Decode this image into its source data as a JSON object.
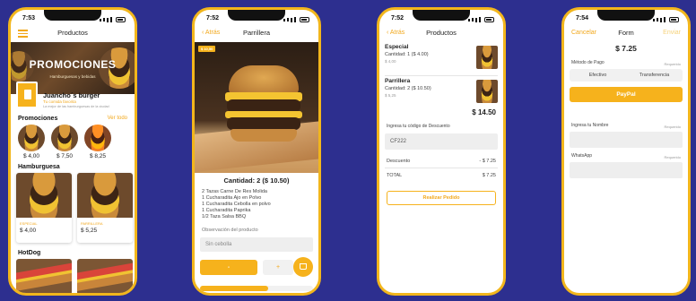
{
  "screen1": {
    "time": "7:53",
    "title": "Productos",
    "banner_text": "PROMOCIONES",
    "banner_sub": "Hamburguesas y bebidas",
    "store_name": "Juancho´s burger",
    "store_sub": "Tu comida favorita",
    "store_desc": "La mejor de las hamburguesas de la ciudad",
    "promos_label": "Promociones",
    "see_all": "Ver todo",
    "promos": [
      {
        "price": "$ 4,00"
      },
      {
        "price": "$ 7,50"
      },
      {
        "price": "$ 8,25"
      }
    ],
    "hamb_label": "Hamburguesa",
    "hamburgers": [
      {
        "name": "ESPECIAL",
        "price": "$ 4,00"
      },
      {
        "name": "PARRILLERA",
        "price": "$ 5,25"
      }
    ],
    "hotdog_label": "HotDog"
  },
  "screen2": {
    "time": "7:52",
    "back": "Atrás",
    "title": "Parrillera",
    "badge": "$ 10,50",
    "quantity": "Cantidad: 2 ($ 10.50)",
    "ingredients": [
      "2 Tazas Carne De Res Molida",
      "1 Cucharadita Ajo en Polvo",
      "1 Cucharadita Cebolla en polvo",
      "1 Cucharadita Paprika",
      "1/2 Taza Salsa BBQ"
    ],
    "obs_label": "Observación del producto",
    "obs_placeholder": "Sin cebolla",
    "minus": "-",
    "plus": "+",
    "progress": 0.6
  },
  "screen3": {
    "time": "7:52",
    "back": "Atrás",
    "title": "Productos",
    "items": [
      {
        "name": "Especial",
        "qty": "Cantidad: 1 ($ 4.00)",
        "sub": "$ 4,00"
      },
      {
        "name": "Parrillera",
        "qty": "Cantidad: 2 ($ 10.50)",
        "sub": "$ 5,25"
      }
    ],
    "subtotal": "$ 14.50",
    "discount_label": "Ingresa tu código de Descuento",
    "discount_code": "CF222",
    "discount_row": "Descuento",
    "discount_value": "- $ 7.25",
    "total_row": "TOTAL",
    "total_value": "$ 7.25",
    "cta": "Realizar Pedido"
  },
  "screen4": {
    "time": "7:54",
    "cancel": "Cancelar",
    "title": "Form",
    "send": "Enviar",
    "amount": "$ 7.25",
    "payment_label": "Método de Pago",
    "required": "Requerido",
    "cash": "Efectivo",
    "transfer": "Transferencia",
    "paypal": "PayPal",
    "name_label": "Ingresa tu Nombre",
    "whatsapp_label": "WhatsApp"
  }
}
